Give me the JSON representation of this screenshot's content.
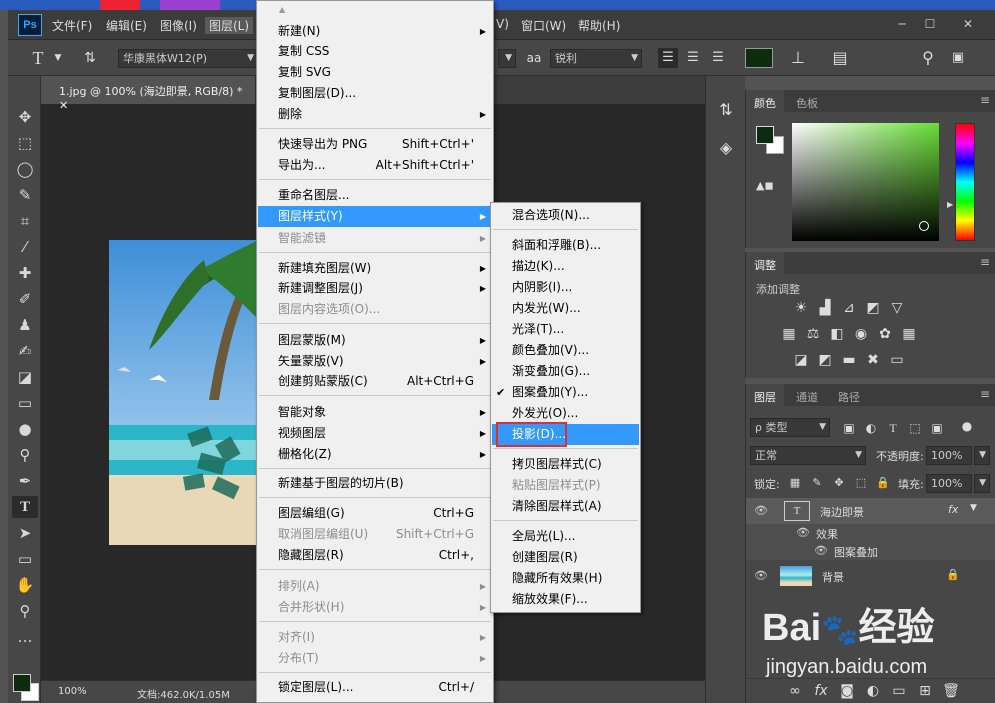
{
  "app": {
    "logo": "Ps",
    "menus": [
      "文件(F)",
      "编辑(E)",
      "图像(I)",
      "图层(L)",
      "V)",
      "窗口(W)",
      "帮助(H)"
    ],
    "window_controls": [
      "─",
      "☐",
      "✕"
    ]
  },
  "options": {
    "font_family": "华康黑体W12(P)",
    "aa_label": "aa",
    "aa_value": "锐利",
    "color": "#0d2c0e"
  },
  "document": {
    "tab_title": "1.jpg @ 100% (海边即景, RGB/8) *",
    "zoom": "100%",
    "doc_info": "文档:462.0K/1.05M"
  },
  "color_panel": {
    "tabs": [
      "颜色",
      "色板"
    ],
    "foreground": "#0d2c0e",
    "hue_color": "#66dd33"
  },
  "adjust_panel": {
    "title": "调整",
    "add_label": "添加调整"
  },
  "layers_panel": {
    "tabs": [
      "图层",
      "通道",
      "路径"
    ],
    "filter_kind": "ρ 类型",
    "blend_mode": "正常",
    "opacity_label": "不透明度:",
    "opacity_value": "100%",
    "lock_label": "锁定:",
    "fill_label": "填充:",
    "fill_value": "100%",
    "layers": [
      {
        "name": "海边即景",
        "fx": "fx"
      },
      {
        "name": "效果"
      },
      {
        "name": "图案叠加"
      },
      {
        "name": "背景"
      }
    ]
  },
  "layer_menu": {
    "items": [
      {
        "label": "新建(N)",
        "sub": "▶"
      },
      {
        "label": "复制 CSS"
      },
      {
        "label": "复制 SVG"
      },
      {
        "label": "复制图层(D)..."
      },
      {
        "label": "删除",
        "sub": "▶"
      },
      {
        "label": "快速导出为 PNG",
        "shortcut": "Shift+Ctrl+'"
      },
      {
        "label": "导出为...",
        "shortcut": "Alt+Shift+Ctrl+'"
      },
      {
        "label": "重命名图层..."
      },
      {
        "label": "图层样式(Y)",
        "sub": "▶"
      },
      {
        "label": "智能滤镜",
        "sub": "▶"
      },
      {
        "label": "新建填充图层(W)",
        "sub": "▶"
      },
      {
        "label": "新建调整图层(J)",
        "sub": "▶"
      },
      {
        "label": "图层内容选项(O)..."
      },
      {
        "label": "图层蒙版(M)",
        "sub": "▶"
      },
      {
        "label": "矢量蒙版(V)",
        "sub": "▶"
      },
      {
        "label": "创建剪贴蒙版(C)",
        "shortcut": "Alt+Ctrl+G"
      },
      {
        "label": "智能对象",
        "sub": "▶"
      },
      {
        "label": "视频图层",
        "sub": "▶"
      },
      {
        "label": "栅格化(Z)",
        "sub": "▶"
      },
      {
        "label": "新建基于图层的切片(B)"
      },
      {
        "label": "图层编组(G)",
        "shortcut": "Ctrl+G"
      },
      {
        "label": "取消图层编组(U)",
        "shortcut": "Shift+Ctrl+G"
      },
      {
        "label": "隐藏图层(R)",
        "shortcut": "Ctrl+,"
      },
      {
        "label": "排列(A)",
        "sub": "▶"
      },
      {
        "label": "合并形状(H)",
        "sub": "▶"
      },
      {
        "label": "对齐(I)",
        "sub": "▶"
      },
      {
        "label": "分布(T)",
        "sub": "▶"
      },
      {
        "label": "锁定图层(L)...",
        "shortcut": "Ctrl+/"
      }
    ]
  },
  "style_menu": {
    "items": [
      {
        "label": "混合选项(N)..."
      },
      {
        "label": "斜面和浮雕(B)..."
      },
      {
        "label": "描边(K)..."
      },
      {
        "label": "内阴影(I)..."
      },
      {
        "label": "内发光(W)..."
      },
      {
        "label": "光泽(T)..."
      },
      {
        "label": "颜色叠加(V)..."
      },
      {
        "label": "渐变叠加(G)..."
      },
      {
        "label": "图案叠加(Y)...",
        "check": "✔"
      },
      {
        "label": "外发光(O)..."
      },
      {
        "label": "投影(D)..."
      },
      {
        "label": "拷贝图层样式(C)"
      },
      {
        "label": "粘贴图层样式(P)"
      },
      {
        "label": "清除图层样式(A)"
      },
      {
        "label": "全局光(L)..."
      },
      {
        "label": "创建图层(R)"
      },
      {
        "label": "隐藏所有效果(H)"
      },
      {
        "label": "缩放效果(F)..."
      }
    ]
  },
  "watermark": {
    "brand": "Bai",
    "brand2": "经验",
    "url": "jingyan.baidu.com"
  }
}
